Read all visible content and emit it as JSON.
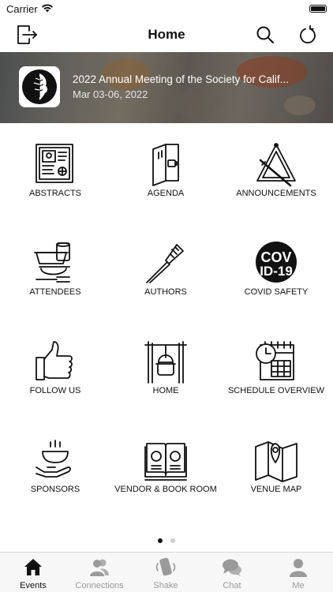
{
  "status_bar": {
    "carrier": "Carrier"
  },
  "nav": {
    "title": "Home"
  },
  "event": {
    "title": "2022 Annual Meeting of the Society for Calif...",
    "date": "Mar 03-06, 2022"
  },
  "grid": [
    {
      "label": "ABSTRACTS",
      "icon": "abstracts-icon"
    },
    {
      "label": "AGENDA",
      "icon": "agenda-icon"
    },
    {
      "label": "ANNOUNCEMENTS",
      "icon": "announcements-icon"
    },
    {
      "label": "ATTENDEES",
      "icon": "attendees-icon"
    },
    {
      "label": "AUTHORS",
      "icon": "authors-icon"
    },
    {
      "label": "COVID SAFETY",
      "icon": "covid-safety-icon"
    },
    {
      "label": "FOLLOW US",
      "icon": "thumbs-up-icon"
    },
    {
      "label": "HOME",
      "icon": "home-pot-icon"
    },
    {
      "label": "SCHEDULE OVERVIEW",
      "icon": "schedule-calendar-icon"
    },
    {
      "label": "SPONSORS",
      "icon": "sponsors-icon"
    },
    {
      "label": "VENDOR & BOOK ROOM",
      "icon": "open-book-icon"
    },
    {
      "label": "VENUE MAP",
      "icon": "map-pin-icon"
    }
  ],
  "covid_icon_text": {
    "line1": "COV",
    "line2": "ID-19"
  },
  "pager": {
    "current": 1,
    "total": 2
  },
  "tabs": [
    {
      "label": "Events",
      "active": true,
      "icon": "house-icon"
    },
    {
      "label": "Connections",
      "active": false,
      "icon": "people-icon"
    },
    {
      "label": "Shake",
      "active": false,
      "icon": "phone-shake-icon"
    },
    {
      "label": "Chat",
      "active": false,
      "icon": "chat-bubbles-icon"
    },
    {
      "label": "Me",
      "active": false,
      "icon": "person-icon"
    }
  ],
  "colors": {
    "active_tab": "#111111",
    "inactive_tab": "#9a9a9a",
    "dot_active": "#111111",
    "dot_inactive": "#cfcfcf"
  }
}
